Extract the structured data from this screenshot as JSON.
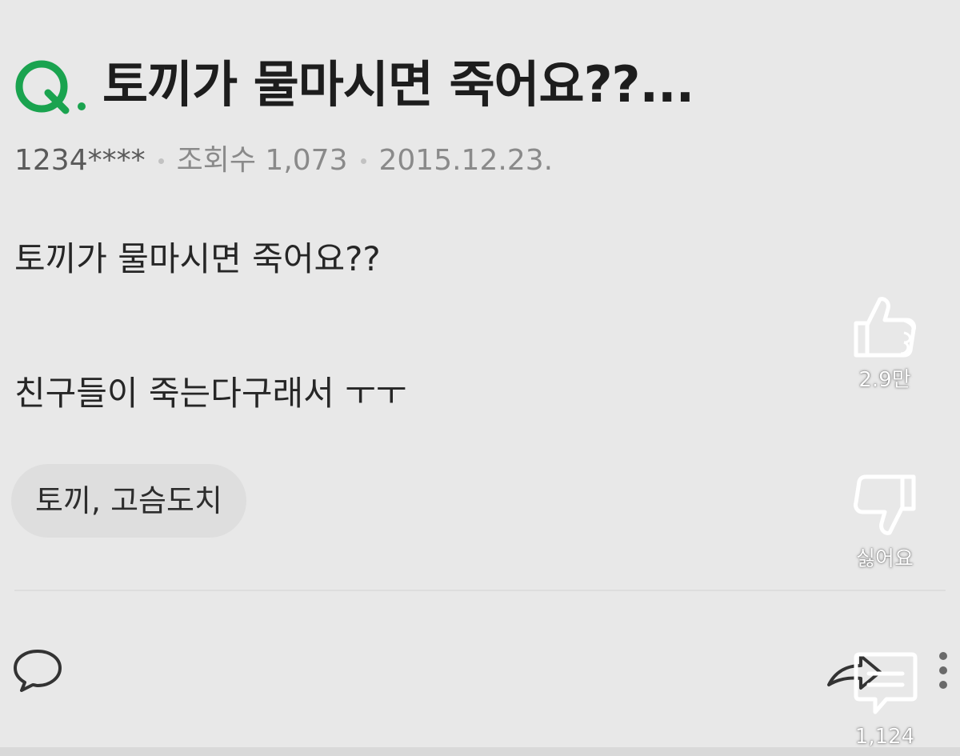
{
  "question": {
    "badge_letter": "Q",
    "title": "토끼가 물마시면 죽어요??...",
    "accent_color": "#1aa34f"
  },
  "meta": {
    "author": "1234****",
    "views": "조회수 1,073",
    "date": "2015.12.23."
  },
  "body": {
    "line1": "토끼가 물마시면 죽어요??",
    "line2": "친구들이 죽는다구래서 ㅜㅜ"
  },
  "tags": {
    "label": "토끼, 고슴도치"
  },
  "side_actions": {
    "like_count": "2.9만",
    "dislike_label": "싫어요",
    "comment_count": "1,124"
  },
  "icons": {
    "like": "thumbs-up-icon",
    "dislike": "thumbs-down-icon",
    "comments": "comment-lines-icon",
    "bottom_comment": "speech-bubble-icon",
    "share": "share-arrow-icon",
    "more": "vertical-dots-icon"
  }
}
